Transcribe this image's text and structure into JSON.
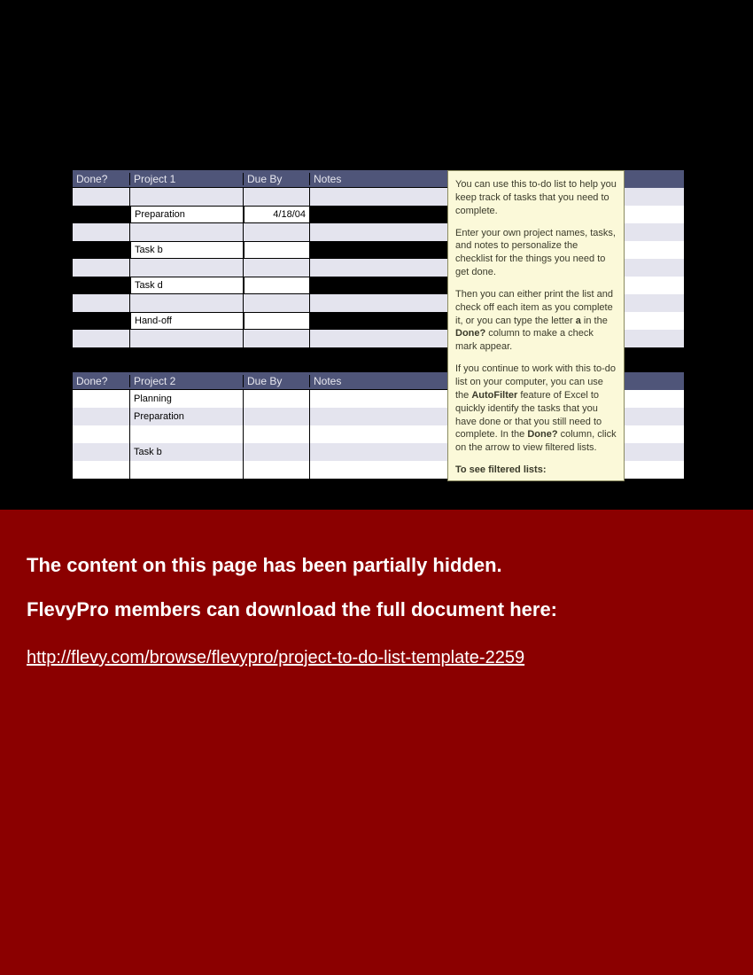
{
  "headers": {
    "done": "Done?",
    "due": "Due By",
    "notes": "Notes"
  },
  "project1": {
    "title": "Project 1",
    "rows": [
      {
        "type": "shade"
      },
      {
        "type": "black",
        "task": "Preparation",
        "due": "4/18/04"
      },
      {
        "type": "shade"
      },
      {
        "type": "black",
        "task": "Task b"
      },
      {
        "type": "shade"
      },
      {
        "type": "black",
        "task": "Task d"
      },
      {
        "type": "shade"
      },
      {
        "type": "black",
        "task": "Hand-off"
      },
      {
        "type": "shade"
      },
      {
        "type": "black-full"
      }
    ]
  },
  "project2": {
    "title": "Project 2",
    "rows": [
      {
        "type": "light",
        "task": "Planning"
      },
      {
        "type": "shade",
        "task": "Preparation"
      },
      {
        "type": "light"
      },
      {
        "type": "shade",
        "task": "Task b"
      },
      {
        "type": "light"
      },
      {
        "type": "shade"
      }
    ]
  },
  "note": {
    "p1a": "You can use this to-do list to help you keep track of tasks that you need to complete.",
    "p2a": "Enter your own project names, tasks, and notes to personalize the checklist for the things you need to get done.",
    "p3a": "Then you can either print the list and check off each item as you complete it, or you can type the letter ",
    "p3b": "a",
    "p3c": " in the ",
    "p3d": "Done?",
    "p3e": " column to make a check mark appear.",
    "p4a": "If you continue to work with this to-do list on your computer, you can use the ",
    "p4b": "AutoFilter",
    "p4c": " feature of Excel to quickly identify the tasks that you have done or that you still need to complete. In the ",
    "p4d": "Done?",
    "p4e": " column, click on the arrow to view filtered lists.",
    "p5a": "To see filtered lists:"
  },
  "overlay": {
    "line1": "The content on this page has been partially hidden.",
    "line2": "FlevyPro members can download the full document here:",
    "link": "http://flevy.com/browse/flevypro/project-to-do-list-template-2259"
  }
}
